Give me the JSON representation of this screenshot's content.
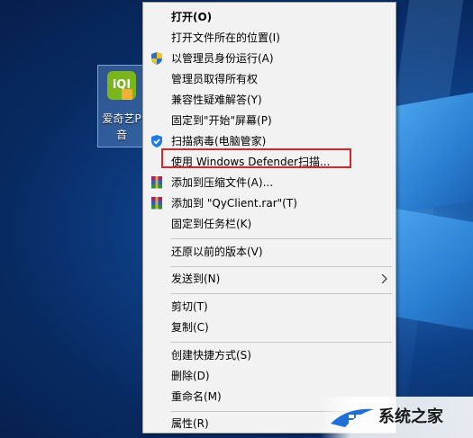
{
  "desktop_icon": {
    "label": "爱奇艺P\n音",
    "line1": "爱奇艺P",
    "line2": "音",
    "glyph": "iQI"
  },
  "context_menu": {
    "items": [
      {
        "label": "打开(O)",
        "bold": true,
        "icon": ""
      },
      {
        "label": "打开文件所在的位置(I)",
        "icon": ""
      },
      {
        "label": "以管理员身份运行(A)",
        "icon": "uac-shield-icon"
      },
      {
        "label": "管理员取得所有权",
        "icon": ""
      },
      {
        "label": "兼容性疑难解答(Y)",
        "icon": ""
      },
      {
        "label": "固定到\"开始\"屏幕(P)",
        "icon": ""
      },
      {
        "label": "扫描病毒(电脑管家)",
        "icon": "tencent-shield-icon"
      },
      {
        "label": "使用 Windows Defender扫描...",
        "icon": "",
        "highlighted": true
      },
      {
        "label": "添加到压缩文件(A)...",
        "icon": "winrar-icon"
      },
      {
        "label": "添加到 \"QyClient.rar\"(T)",
        "icon": "winrar-icon"
      },
      {
        "label": "固定到任务栏(K)",
        "icon": ""
      },
      {
        "label": "还原以前的版本(V)",
        "icon": ""
      },
      {
        "label": "发送到(N)",
        "icon": "",
        "submenu": true
      },
      {
        "label": "剪切(T)",
        "icon": ""
      },
      {
        "label": "复制(C)",
        "icon": ""
      },
      {
        "label": "创建快捷方式(S)",
        "icon": ""
      },
      {
        "label": "删除(D)",
        "icon": ""
      },
      {
        "label": "重命名(M)",
        "icon": ""
      },
      {
        "label": "属性(R)",
        "icon": ""
      }
    ]
  },
  "watermark": {
    "text": "系统之家"
  },
  "colors": {
    "highlight_border": "#d9262a",
    "menu_bg": "#f2f2f2"
  }
}
